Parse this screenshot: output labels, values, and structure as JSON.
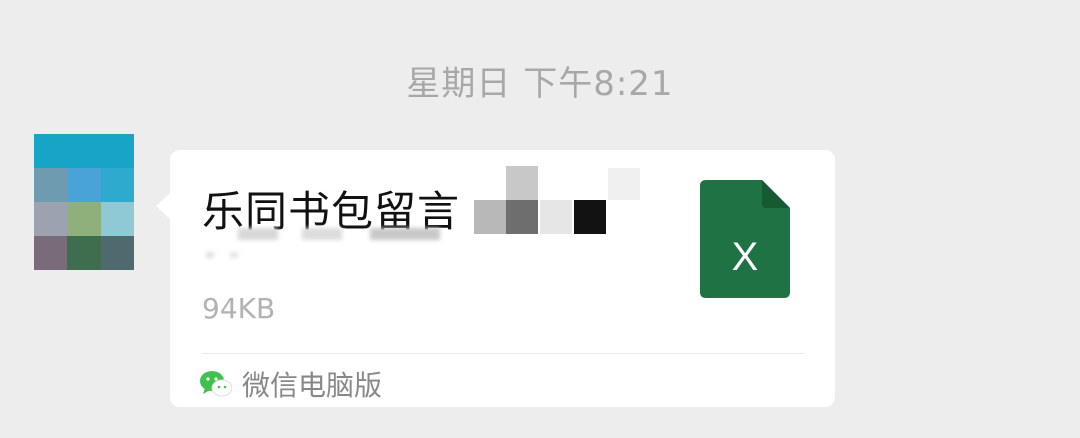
{
  "timestamp": "星期日 下午8:21",
  "sender": {
    "avatar_colors": [
      "#18a4c6",
      "#18a4c6",
      "#18a4c6",
      "#6e9bb0",
      "#4aa3d6",
      "#2eaace",
      "#9da2b0",
      "#8fb07a",
      "#8ec9d5",
      "#7a6b7a",
      "#3f6e4f",
      "#4f6a6e"
    ]
  },
  "message": {
    "file_name": "乐同书包留言",
    "file_size": "94KB",
    "file_icon": {
      "name": "excel-file-icon",
      "letter": "X",
      "color": "#1f7244"
    },
    "source_icon": "wechat-icon",
    "source_label": "微信电脑版"
  }
}
